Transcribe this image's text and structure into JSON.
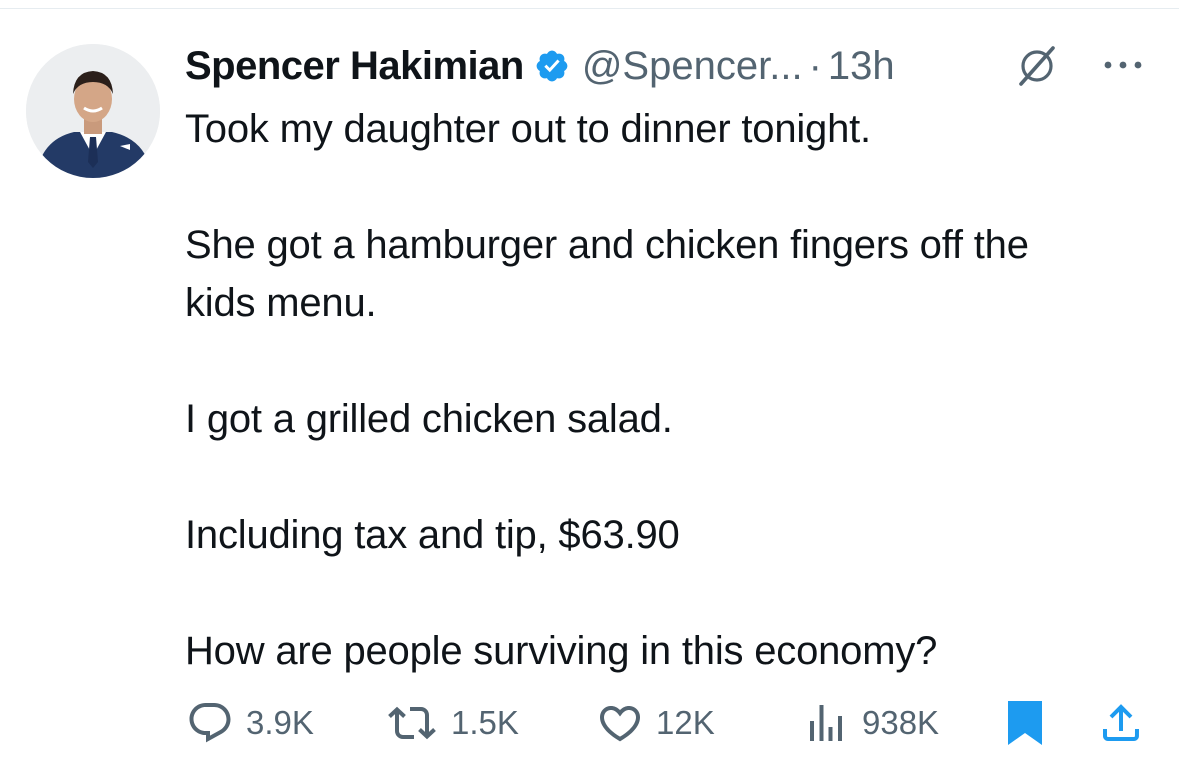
{
  "author": {
    "name": "Spencer Hakimian",
    "handle": "@Spencer...",
    "separator": "·",
    "time": "13h",
    "verified": true
  },
  "tweet": {
    "paragraphs": [
      [
        "Took my daughter out to dinner tonight."
      ],
      [
        "She got a hamburger and chicken fingers off the",
        "kids menu."
      ],
      [
        "I got a grilled chicken salad."
      ],
      [
        "Including tax and tip, $63.90"
      ],
      [
        "How are people surviving in this economy?"
      ]
    ]
  },
  "actions": {
    "replies": "3.9K",
    "reposts": "1.5K",
    "likes": "12K",
    "views": "938K"
  },
  "icons": {
    "verified": "verified-badge-icon",
    "grok": "grok-icon",
    "more": "more-icon",
    "reply": "reply-icon",
    "repost": "repost-icon",
    "like": "like-icon",
    "views": "views-icon",
    "bookmark": "bookmark-icon",
    "share": "share-icon"
  },
  "colors": {
    "text": "#0f1419",
    "secondary": "#536471",
    "accent": "#1d9bf0"
  }
}
